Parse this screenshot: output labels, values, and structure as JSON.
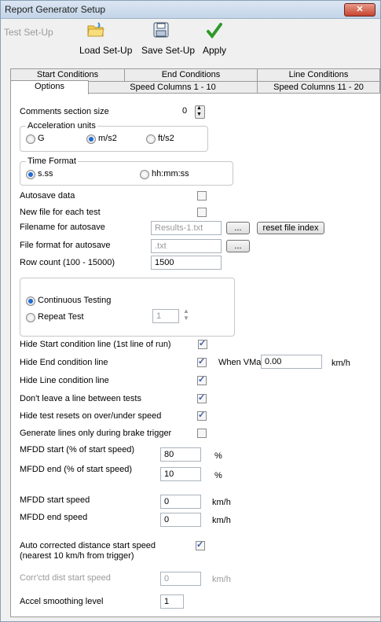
{
  "window": {
    "title": "Report Generator Setup",
    "close": "✕"
  },
  "toolbar": {
    "test_setup": "Test Set-Up",
    "load_setup": "Load Set-Up",
    "save_setup": "Save Set-Up",
    "apply": "Apply"
  },
  "tabs_top": [
    "Start Conditions",
    "End Conditions",
    "Line Conditions"
  ],
  "tabs_bottom": [
    "Options",
    "Speed Columns 1 - 10",
    "Speed Columns 11 - 20"
  ],
  "options": {
    "comments_label": "Comments section size",
    "comments_value": "0",
    "accel_legend": "Acceleration units",
    "accel_g": "G",
    "accel_ms2": "m/s2",
    "accel_fts2": "ft/s2",
    "time_legend": "Time Format",
    "time_sss": "s.ss",
    "time_hh": "hh:mm:ss",
    "autosave_label": "Autosave data",
    "newfile_label": "New file for each test",
    "filename_label": "Filename for autosave",
    "filename_value": "Results-1.txt",
    "browse_label": "...",
    "reset_index": "reset file index",
    "fileformat_label": "File format for autosave",
    "fileformat_value": ".txt",
    "rowcount_label": "Row count (100 - 15000)",
    "rowcount_value": "1500",
    "continuous_label": "Continuous Testing",
    "repeat_label": "Repeat Test",
    "repeat_value": "1",
    "hide_start": "Hide Start condition line (1st line of run)",
    "hide_end": "Hide End condition line",
    "when_vmax": "When VMax <",
    "vmax_value": "0.00",
    "vmax_unit": "km/h",
    "hide_line": "Hide Line condition line",
    "dont_leave": "Don't leave a line between tests",
    "hide_resets": "Hide test resets on over/under speed",
    "gen_lines": "Generate lines only during brake trigger",
    "mfdd_start_pct": "MFDD start (% of start speed)",
    "mfdd_start_pct_value": "80",
    "mfdd_end_pct": "MFDD end (% of start speed)",
    "mfdd_end_pct_value": "10",
    "percent": "%",
    "mfdd_start_speed": "MFDD start speed",
    "mfdd_start_speed_value": "0",
    "mfdd_end_speed": "MFDD end speed",
    "mfdd_end_speed_value": "0",
    "kmh": "km/h",
    "auto_corr_1": "Auto corrected distance start speed",
    "auto_corr_2": "(nearest 10 km/h from trigger)",
    "corr_dist_label": "Corr'ctd dist start speed",
    "corr_dist_value": "0",
    "accel_smooth_label": "Accel smoothing level",
    "accel_smooth_value": "1"
  }
}
